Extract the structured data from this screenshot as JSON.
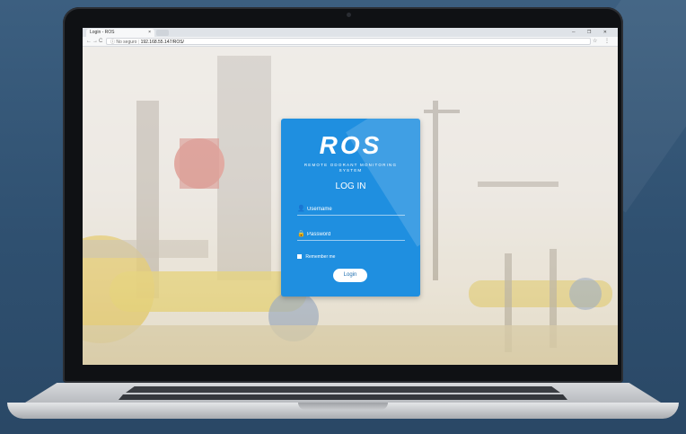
{
  "browser": {
    "tab_title": "Login - ROS",
    "tab_close": "×",
    "window_controls": "─ ❐ ✕",
    "back": "←",
    "forward": "→",
    "reload": "C",
    "security_label": "ⓘ No seguro",
    "url": "192.168.55.147/ROS/",
    "toolbar_icons": "☆ ⋮"
  },
  "login": {
    "logo_text": "ROS",
    "logo_subtitle_line1": "REMOTE ODORANT MONITORING",
    "logo_subtitle_line2": "SYSTEM",
    "heading": "LOG IN",
    "username_placeholder": "Username",
    "password_placeholder": "Password",
    "remember_label": "Remember me",
    "button_label": "Login"
  },
  "colors": {
    "card_blue": "#1f8fe0",
    "background": "#3c5f80"
  }
}
